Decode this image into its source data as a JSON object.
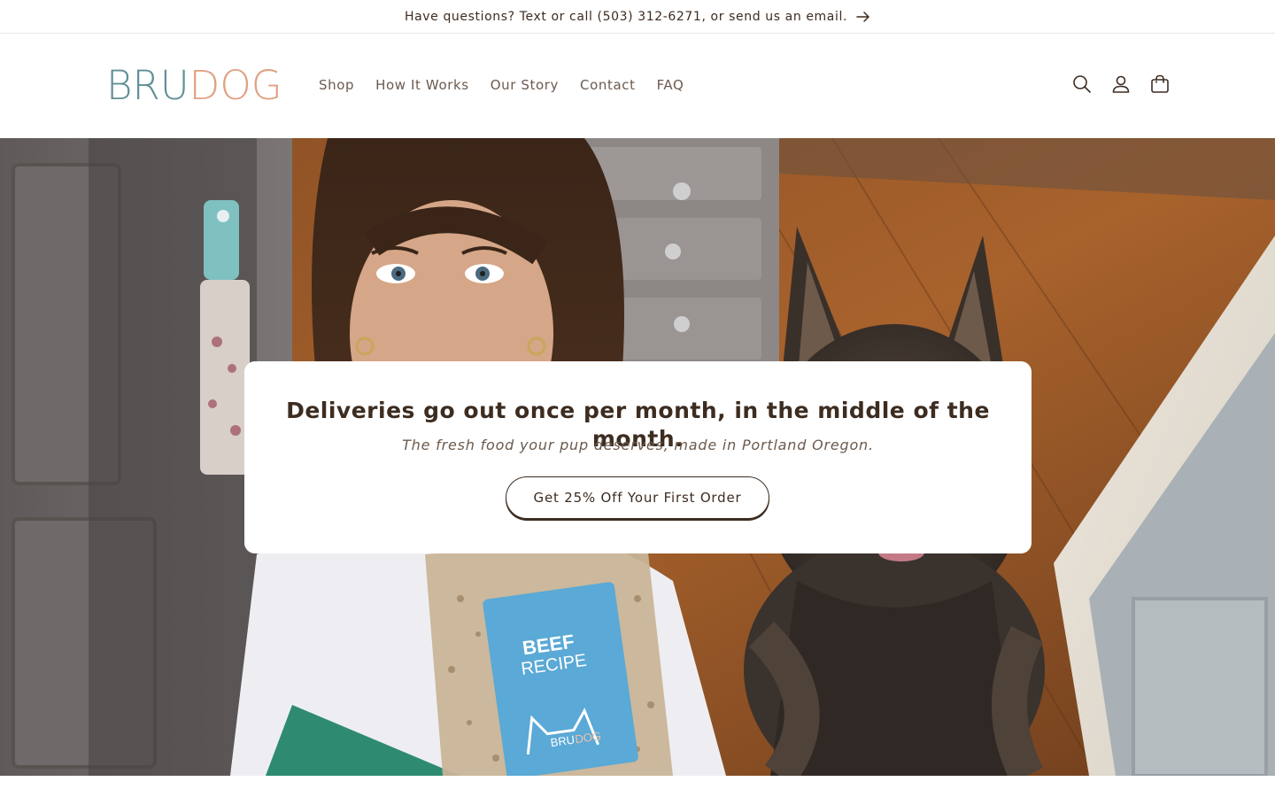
{
  "announcement": {
    "text": "Have questions? Text or call (503) 312-6271, or send us an email.",
    "icon": "arrow-right-icon"
  },
  "header": {
    "logo": {
      "part1": "BRU",
      "part2": "DOG"
    },
    "nav": [
      {
        "label": "Shop"
      },
      {
        "label": "How It Works"
      },
      {
        "label": "Our Story"
      },
      {
        "label": "Contact"
      },
      {
        "label": "FAQ"
      }
    ],
    "icons": [
      "search-icon",
      "account-icon",
      "cart-icon"
    ]
  },
  "hero": {
    "title": "Deliveries go out once per month, in the middle of the month.",
    "subtitle": "The fresh food your pup deserves, made in Portland Oregon.",
    "cta": "Get 25% Off Your First Order",
    "bag": {
      "line1": "BEEF",
      "line2": "RECIPE",
      "brand1": "BRU",
      "brand2": "DOG"
    }
  },
  "colors": {
    "text": "#3d2c20",
    "nav_text": "#6b5a4e",
    "logo_bru": "#5f8f97",
    "logo_dog": "#e0a183",
    "bag_blue": "#5aa9d6"
  }
}
